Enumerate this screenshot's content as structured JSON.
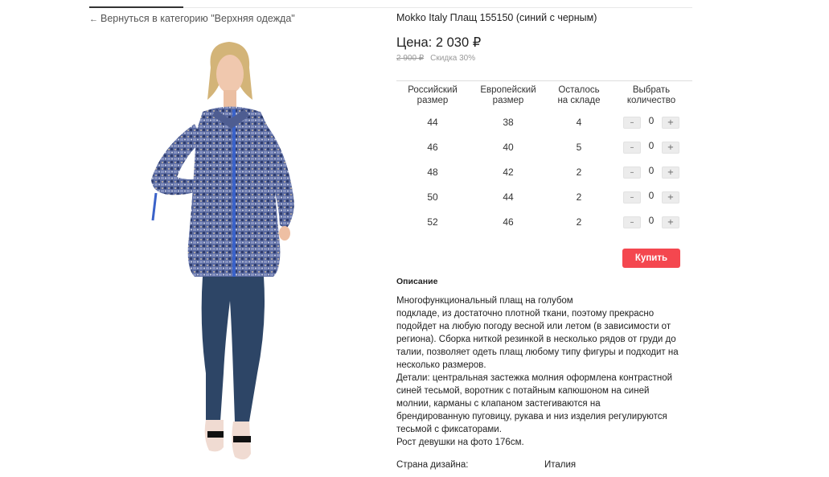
{
  "nav": {
    "back_arrow": "←",
    "back_label": "Вернуться в категорию \"Верхняя одежда\""
  },
  "product": {
    "title": "Mokko Italy Плащ 155150 (синий с черным)",
    "price": "Цена: 2 030 ₽",
    "old_price": "2 900 ₽",
    "discount": "Скидка 30%"
  },
  "sizes_table": {
    "headers": {
      "ru_line1": "Российский",
      "ru_line2": "размер",
      "eu_line1": "Европейский",
      "eu_line2": "размер",
      "stock_line1": "Осталось",
      "stock_line2": "на складе",
      "qty_line1": "Выбрать",
      "qty_line2": "количество"
    },
    "rows": [
      {
        "ru": "44",
        "eu": "38",
        "stock": "4",
        "qty": "0"
      },
      {
        "ru": "46",
        "eu": "40",
        "stock": "5",
        "qty": "0"
      },
      {
        "ru": "48",
        "eu": "42",
        "stock": "2",
        "qty": "0"
      },
      {
        "ru": "50",
        "eu": "44",
        "stock": "2",
        "qty": "0"
      },
      {
        "ru": "52",
        "eu": "46",
        "stock": "2",
        "qty": "0"
      }
    ],
    "minus_label": "–",
    "plus_label": "+"
  },
  "buy_button": "Купить",
  "description": {
    "heading": "Описание",
    "lines": [
      "Многофункциональный плащ на голубом",
      "подкладе,  из  достаточно плотной ткани,  поэтому прекрасно",
      "подойдет на любую погоду весной или летом (в зависимости от",
      "региона). Сборка ниткой резинкой в несколько рядов от груди до",
      "талии, позволяет одеть плащ любому типу фигуры и подходит на",
      "несколько размеров.",
      "Детали: центральная застежка молния оформлена контрастной",
      "синей тесьмой, воротник с потайным капюшоном на синей",
      "молнии, карманы с клапаном застегиваются на",
      "брендированную  пуговицу, рукава и низ изделия регулируются",
      "тесьмой с фиксаторами.",
      "Рост девушки на фото 176см."
    ]
  },
  "attributes": {
    "country_label": "Страна дизайна:",
    "country_value": "Италия"
  },
  "colors": {
    "accent": "#f4474f",
    "coat_blue": "#3a62c9",
    "jeans": "#2d4566"
  }
}
